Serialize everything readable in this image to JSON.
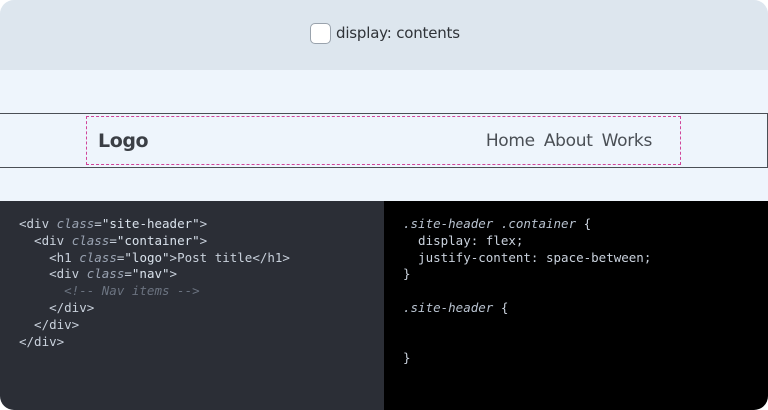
{
  "toggle": {
    "label": "display: contents",
    "checked": false
  },
  "preview": {
    "logo": "Logo",
    "nav_items": [
      "Home",
      "About",
      "Works"
    ]
  },
  "html_code": {
    "lines": [
      "<div class=\"site-header\">",
      "  <div class=\"container\">",
      "    <h1 class=\"logo\">Post title</h1>",
      "    <div class=\"nav\">",
      "      <!-- Nav items -->",
      "    </div>",
      "  </div>",
      "</div>"
    ]
  },
  "css_code": {
    "lines": [
      ".site-header .container {",
      "  display: flex;",
      "  justify-content: space-between;",
      "}",
      "",
      ".site-header {",
      "",
      "",
      "}"
    ]
  },
  "colors": {
    "container_outline": "#d0459a",
    "html_panel_bg": "#2b2e36",
    "css_panel_bg": "#000000"
  }
}
